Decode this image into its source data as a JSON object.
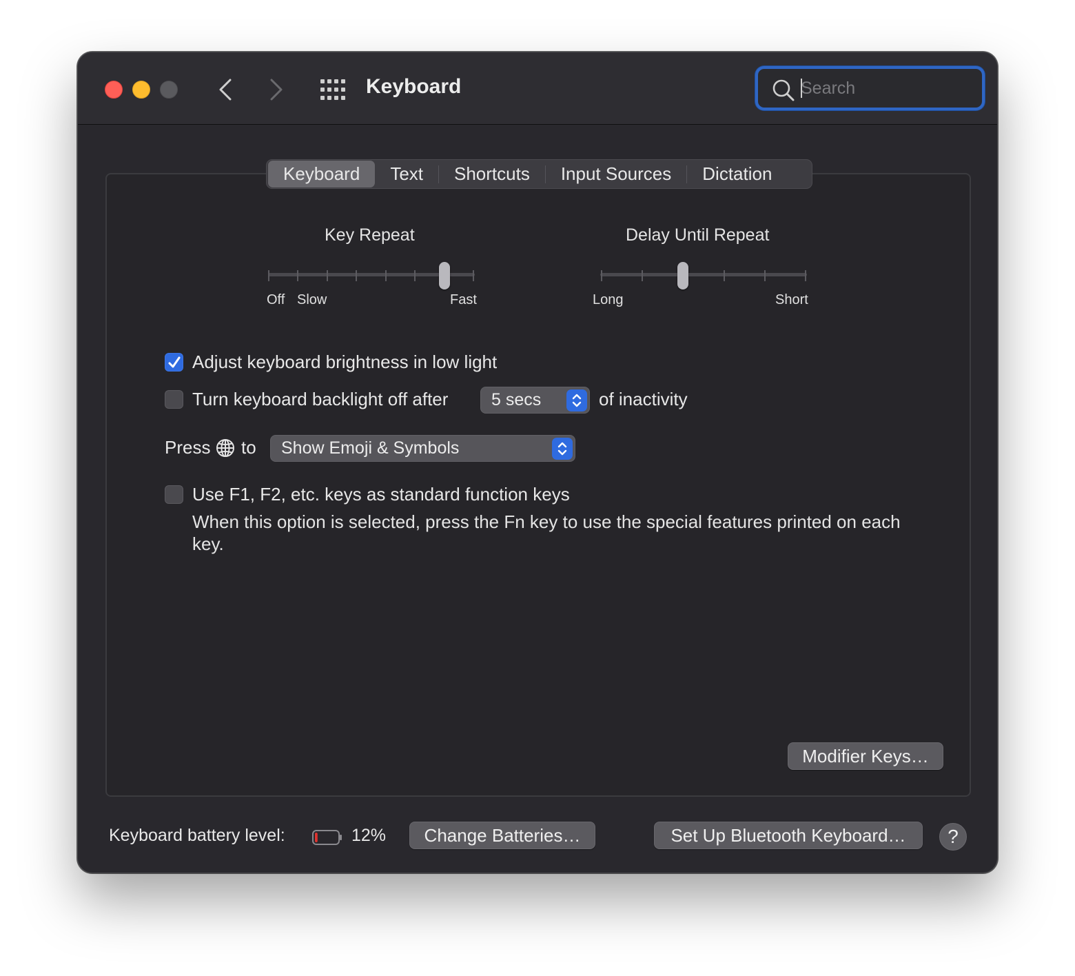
{
  "window": {
    "title": "Keyboard",
    "search_placeholder": "Search"
  },
  "tabs": [
    {
      "label": "Keyboard",
      "active": true
    },
    {
      "label": "Text",
      "active": false
    },
    {
      "label": "Shortcuts",
      "active": false
    },
    {
      "label": "Input Sources",
      "active": false
    },
    {
      "label": "Dictation",
      "active": false
    }
  ],
  "key_repeat": {
    "title": "Key Repeat",
    "label_off": "Off",
    "label_slow": "Slow",
    "label_fast": "Fast",
    "tick_count": 8,
    "selected_index": 6
  },
  "delay_until_repeat": {
    "title": "Delay Until Repeat",
    "label_long": "Long",
    "label_short": "Short",
    "tick_count": 6,
    "selected_index": 2
  },
  "options": {
    "adjust_brightness": {
      "label": "Adjust keyboard brightness in low light",
      "checked": true
    },
    "backlight_off": {
      "label": "Turn keyboard backlight off after",
      "checked": false,
      "value": "5 secs",
      "suffix": "of inactivity"
    },
    "press_globe": {
      "prefix": "Press",
      "suffix": "to",
      "value": "Show Emoji & Symbols"
    },
    "function_keys": {
      "label": "Use F1, F2, etc. keys as standard function keys",
      "checked": false,
      "description": "When this option is selected, press the Fn key to use the special features printed on each key."
    }
  },
  "buttons": {
    "modifier_keys": "Modifier Keys…",
    "change_batteries": "Change Batteries…",
    "setup_bluetooth": "Set Up Bluetooth Keyboard…",
    "help": "?"
  },
  "battery": {
    "label": "Keyboard battery level:",
    "percent_text": "12%",
    "level": 0.12,
    "color": "#e0332f"
  }
}
